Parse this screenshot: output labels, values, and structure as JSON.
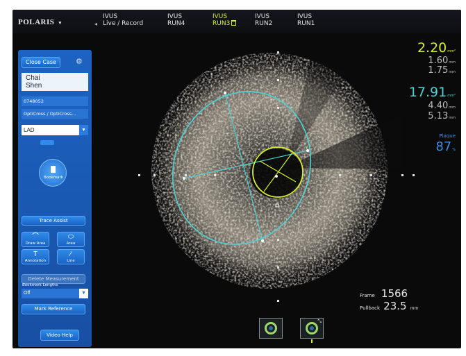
{
  "header": {
    "brand": "POLARIS",
    "brand_caret": "▾",
    "runs": [
      {
        "line1": "IVUS",
        "line2": "Live / Record"
      },
      {
        "line1": "IVUS",
        "line2": "RUN4"
      },
      {
        "line1": "IVUS",
        "line2": "RUN3"
      },
      {
        "line1": "IVUS",
        "line2": "RUN2"
      },
      {
        "line1": "IVUS",
        "line2": "RUN1"
      }
    ]
  },
  "sidebar": {
    "close_case": "Close Case",
    "patient_first": "Chai",
    "patient_last": "Shen",
    "patient_id": "0748052",
    "catheter": "OptiCross / OptiCross...",
    "vessel": "LAD",
    "bookmark": "Bookmark",
    "trace_assist": "Trace Assist",
    "draw_area": "Draw Area",
    "area": "Area",
    "annotation": "Annotation",
    "line": "Line",
    "delete_measurement": "Delete Measurement",
    "bookmark_lengths_label": "Bookmark Lengths",
    "bookmark_lengths_value": "Off",
    "mark_reference": "Mark Reference",
    "video_help": "Video Help"
  },
  "readouts": {
    "lumen_area": "2.20",
    "lumen_area_unit": "mm²",
    "lumen_d1": "1.60",
    "lumen_d2": "1.75",
    "mm": "mm",
    "vessel_area": "17.91",
    "vessel_area_unit": "mm²",
    "vessel_d1": "4.40",
    "vessel_d2": "5.13",
    "plaque_label": "Plaque",
    "plaque_value": "87",
    "plaque_unit": "%"
  },
  "frame": {
    "frame_label": "Frame",
    "frame_value": "1566",
    "pullback_label": "Pullback",
    "pullback_value": "23.5",
    "pullback_unit": "mm"
  },
  "colors": {
    "lumen_yellow": "#d9ee2b",
    "vessel_cyan": "#4fd1d6",
    "plaque_blue": "#3f8fe8",
    "panel_blue": "#1d63c2"
  }
}
